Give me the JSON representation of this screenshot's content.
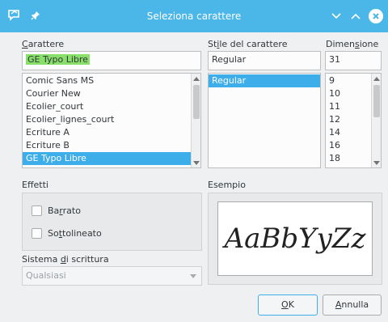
{
  "window": {
    "title": "Seleziona carattere",
    "titlebar_color": "#4bb6e8",
    "icons": [
      "app-icon",
      "pin-icon"
    ],
    "controls": [
      "minimize-icon",
      "maximize-icon",
      "close-icon"
    ]
  },
  "font": {
    "label_pre": "",
    "label_key": "C",
    "label_post": "arattere",
    "value": "GE Typo Libre",
    "items": [
      "Comic Sans MS",
      "Courier New",
      "Ecolier_court",
      "Ecolier_lignes_court",
      "Ecriture A",
      "Ecriture B",
      "GE Typo Libre"
    ],
    "selected_index": 6
  },
  "style": {
    "label_pre": "St",
    "label_key": "i",
    "label_post": "le del carattere",
    "value": "Regular",
    "items": [
      "Regular"
    ],
    "selected_index": 0
  },
  "size": {
    "label_pre": "Dimen",
    "label_key": "s",
    "label_post": "ione",
    "value": "31",
    "items": [
      "9",
      "10",
      "11",
      "12",
      "14",
      "16",
      "18"
    ]
  },
  "effects": {
    "title": "Effetti",
    "strikeout_pre": "Ba",
    "strikeout_key": "r",
    "strikeout_post": "rato",
    "underline_pre": "So",
    "underline_key": "t",
    "underline_post": "tolineato",
    "strikeout_checked": false,
    "underline_checked": false
  },
  "writing_system": {
    "label_pre": "Sistema ",
    "label_key": "d",
    "label_post": "i scrittura",
    "value": "Qualsiasi"
  },
  "sample": {
    "title": "Esempio",
    "text": "AaBbYyZz"
  },
  "buttons": {
    "ok_key": "O",
    "ok_post": "K",
    "cancel_key": "A",
    "cancel_post": "nnulla"
  },
  "colors": {
    "selection": "#3daee9",
    "highlight": "#88e06a"
  }
}
